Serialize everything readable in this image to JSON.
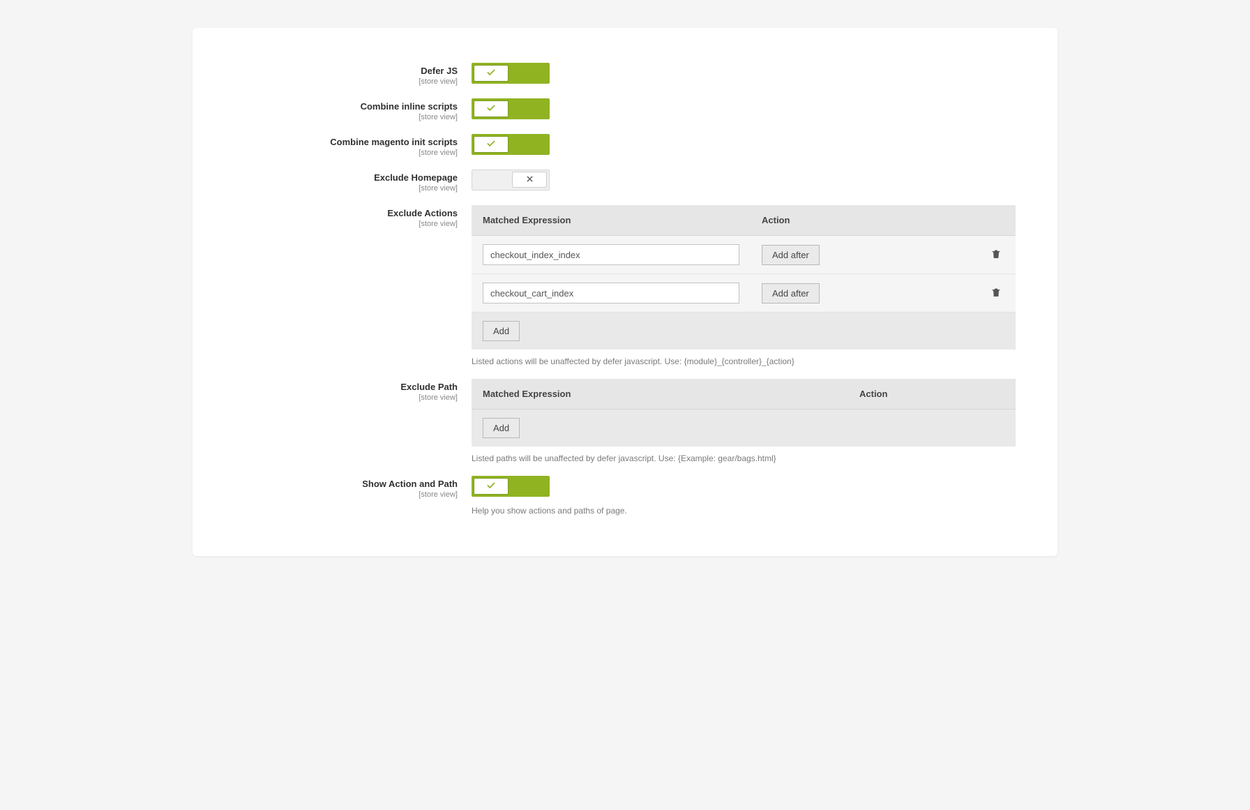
{
  "scope_label": "[store view]",
  "fields": {
    "defer_js": {
      "label": "Defer JS",
      "value": true
    },
    "combine_inline": {
      "label": "Combine inline scripts",
      "value": true
    },
    "combine_init": {
      "label": "Combine magento init scripts",
      "value": true
    },
    "exclude_homepage": {
      "label": "Exclude Homepage",
      "value": false
    },
    "show_action_path": {
      "label": "Show Action and Path",
      "value": true,
      "hint": "Help you show actions and paths of page."
    }
  },
  "exclude_actions": {
    "label": "Exclude Actions",
    "columns": {
      "expr": "Matched Expression",
      "action": "Action"
    },
    "rows": [
      {
        "value": "checkout_index_index",
        "add_after_label": "Add after"
      },
      {
        "value": "checkout_cart_index",
        "add_after_label": "Add after"
      }
    ],
    "add_label": "Add",
    "hint": "Listed actions will be unaffected by defer javascript. Use: {module}_{controller}_{action}"
  },
  "exclude_path": {
    "label": "Exclude Path",
    "columns": {
      "expr": "Matched Expression",
      "action": "Action"
    },
    "rows": [],
    "add_label": "Add",
    "hint": "Listed paths will be unaffected by defer javascript. Use: {Example: gear/bags.html}"
  }
}
